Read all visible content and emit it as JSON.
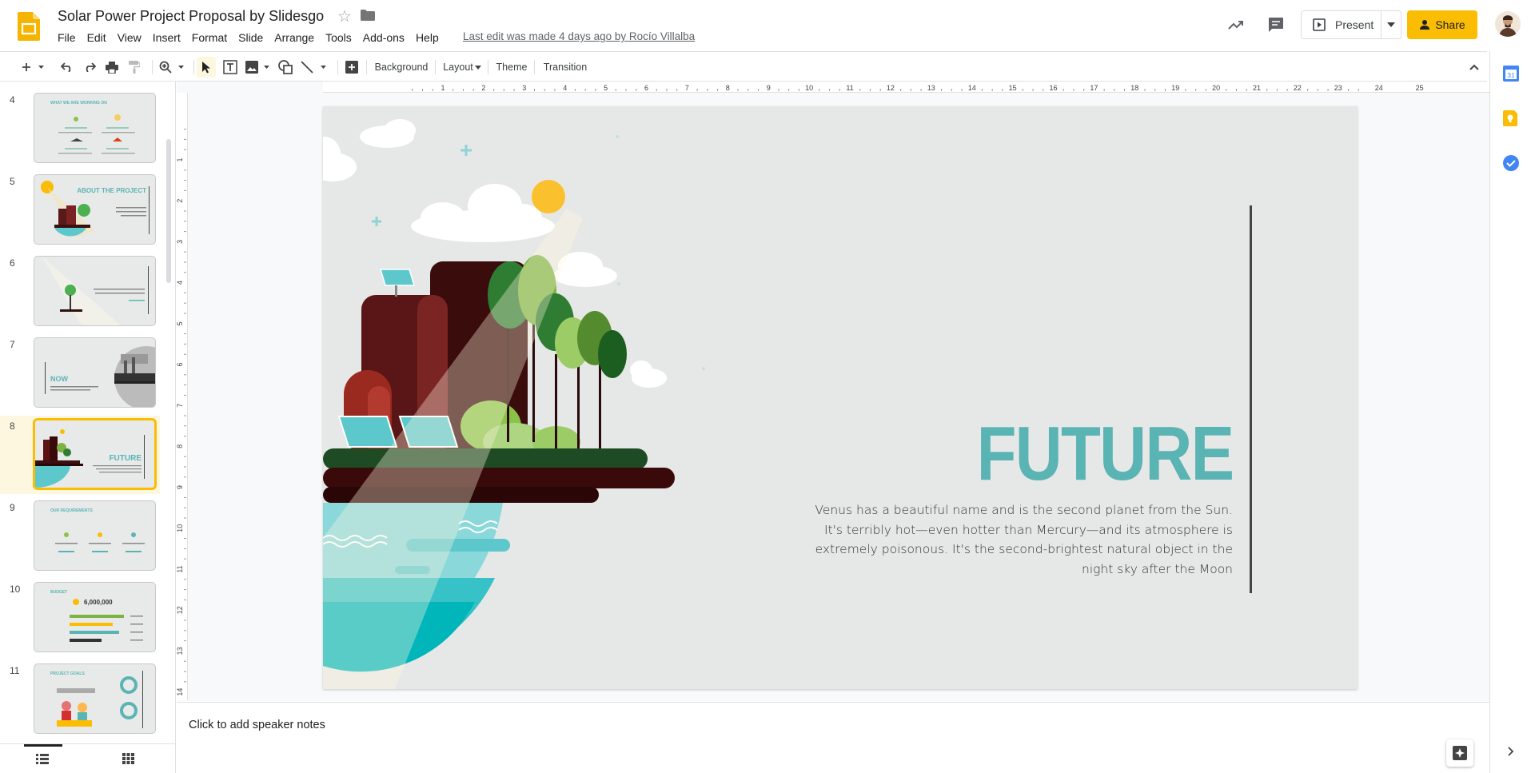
{
  "app": {
    "title": "Solar Power Project Proposal by Slidesgo",
    "last_edit": "Last edit was made 4 days ago by Rocío Villalba",
    "menu": [
      "File",
      "Edit",
      "View",
      "Insert",
      "Format",
      "Slide",
      "Arrange",
      "Tools",
      "Add-ons",
      "Help"
    ],
    "present_label": "Present",
    "share_label": "Share"
  },
  "toolbar": {
    "background_label": "Background",
    "layout_label": "Layout",
    "theme_label": "Theme",
    "transition_label": "Transition"
  },
  "ruler": {
    "h_ticks": [
      "1",
      "2",
      "3",
      "4",
      "5",
      "6",
      "7",
      "8",
      "9",
      "10",
      "11",
      "12",
      "13",
      "14",
      "15",
      "16",
      "17",
      "18",
      "19",
      "20",
      "21",
      "22",
      "23",
      "24",
      "25"
    ],
    "v_ticks": [
      "1",
      "2",
      "3",
      "4",
      "5",
      "6",
      "7",
      "8",
      "9",
      "10",
      "11",
      "12",
      "13",
      "14"
    ]
  },
  "slides": [
    {
      "num": "4",
      "text": "WHAT WE ARE WORKING ON"
    },
    {
      "num": "5",
      "text": "ABOUT THE PROJECT"
    },
    {
      "num": "6",
      "text": ""
    },
    {
      "num": "7",
      "text": "NOW"
    },
    {
      "num": "8",
      "text": "FUTURE",
      "selected": true
    },
    {
      "num": "9",
      "text": "OUR REQUIREMENTS"
    },
    {
      "num": "10",
      "text": "BUDGET",
      "value": "6,000,000"
    },
    {
      "num": "11",
      "text": "PROJECT GOALS"
    }
  ],
  "current_slide": {
    "title": "FUTURE",
    "body": "Venus has a beautiful name and is the second planet from the Sun. It's terribly hot—even hotter than Mercury—and its atmosphere is extremely poisonous. It's the second-brightest natural object in the night sky after the Moon"
  },
  "notes": {
    "placeholder": "Click to add speaker notes"
  },
  "colors": {
    "accent": "#fbbc04",
    "teal": "#5ab4b4",
    "slide_bg": "#e6e8e7"
  }
}
